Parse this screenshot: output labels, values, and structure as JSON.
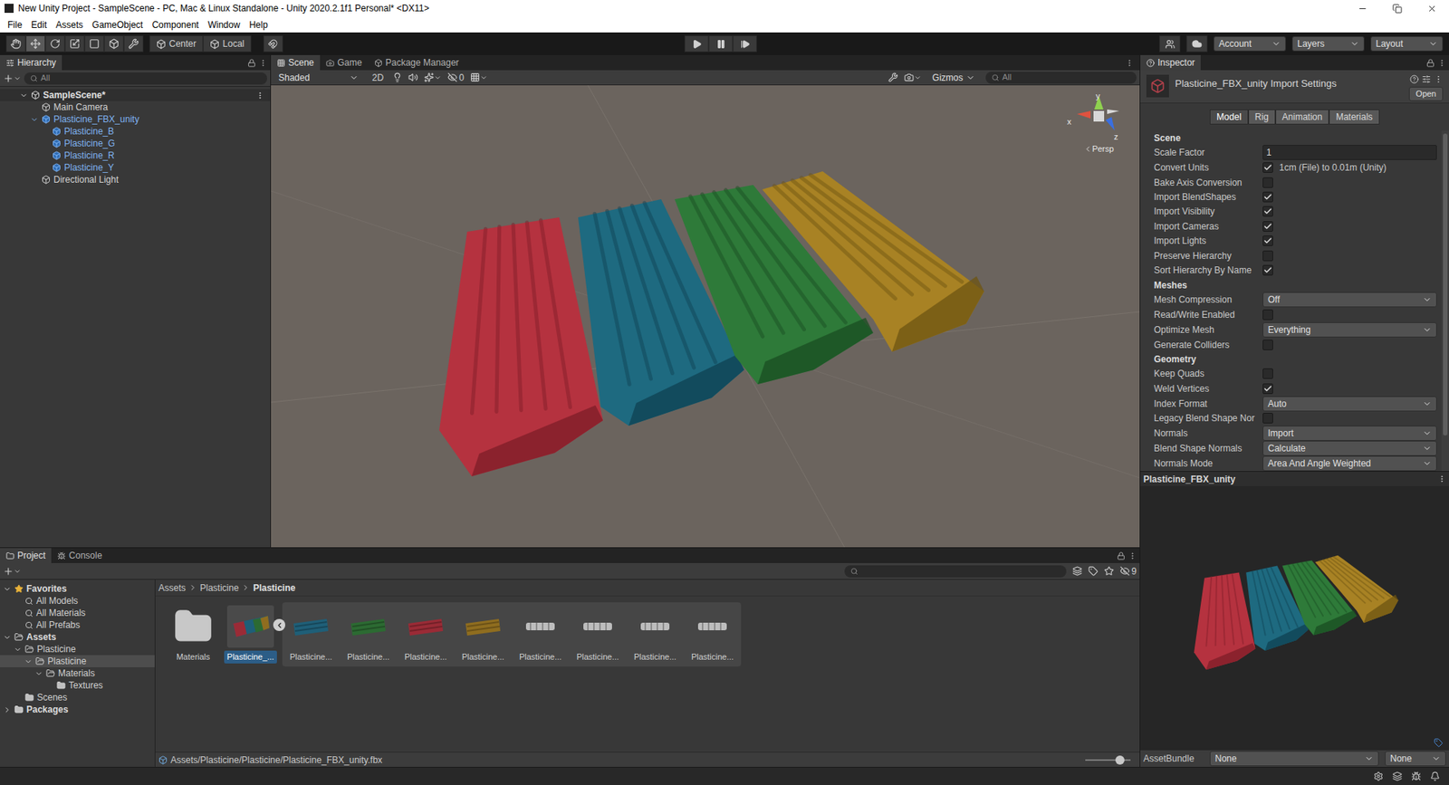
{
  "window": {
    "title": "New Unity Project - SampleScene - PC, Mac & Linux Standalone - Unity 2020.2.1f1 Personal* <DX11>"
  },
  "menu": [
    "File",
    "Edit",
    "Assets",
    "GameObject",
    "Component",
    "Window",
    "Help"
  ],
  "toolbar": {
    "tools": [
      {
        "selected": false
      },
      {
        "selected": true
      },
      {
        "selected": false
      },
      {
        "selected": false
      },
      {
        "selected": false
      },
      {
        "selected": false
      },
      {
        "selected": false
      }
    ],
    "pivot": "Center",
    "space": "Local",
    "account": "Account",
    "layers": "Layers",
    "layout": "Layout"
  },
  "hierarchy": {
    "tab": "Hierarchy",
    "search": "All",
    "items": [
      {
        "label": "SampleScene*",
        "depth": 0,
        "kind": "scene",
        "foldout": "open"
      },
      {
        "label": "Main Camera",
        "depth": 1,
        "kind": "object",
        "foldout": "none"
      },
      {
        "label": "Plasticine_FBX_unity",
        "depth": 1,
        "kind": "prefab",
        "foldout": "open"
      },
      {
        "label": "Plasticine_B",
        "depth": 2,
        "kind": "prefab",
        "foldout": "none"
      },
      {
        "label": "Plasticine_G",
        "depth": 2,
        "kind": "prefab",
        "foldout": "none"
      },
      {
        "label": "Plasticine_R",
        "depth": 2,
        "kind": "prefab",
        "foldout": "none"
      },
      {
        "label": "Plasticine_Y",
        "depth": 2,
        "kind": "prefab",
        "foldout": "none"
      },
      {
        "label": "Directional Light",
        "depth": 1,
        "kind": "object",
        "foldout": "none"
      }
    ]
  },
  "scene": {
    "tabs": [
      {
        "label": "Scene",
        "selected": true
      },
      {
        "label": "Game",
        "selected": false
      },
      {
        "label": "Package Manager",
        "selected": false
      }
    ],
    "shading": "Shaded",
    "mode2d": "2D",
    "hidden_count": "0",
    "gizmos": "Gizmos",
    "search": "All",
    "projection": "Persp",
    "axes": {
      "x": "x",
      "y": "y",
      "z": "z"
    }
  },
  "inspector": {
    "tab": "Inspector",
    "title": "Plasticine_FBX_unity Import Settings",
    "open": "Open",
    "tabs": [
      {
        "label": "Model",
        "selected": true
      },
      {
        "label": "Rig",
        "selected": false
      },
      {
        "label": "Animation",
        "selected": false
      },
      {
        "label": "Materials",
        "selected": false
      }
    ],
    "rows": [
      {
        "kind": "header",
        "label": "Scene"
      },
      {
        "kind": "field",
        "label": "Scale Factor",
        "value": "1"
      },
      {
        "kind": "checkbox",
        "label": "Convert Units",
        "checked": true,
        "note": "1cm (File) to 0.01m (Unity)"
      },
      {
        "kind": "checkbox",
        "label": "Bake Axis Conversion",
        "checked": false
      },
      {
        "kind": "checkbox",
        "label": "Import BlendShapes",
        "checked": true
      },
      {
        "kind": "checkbox",
        "label": "Import Visibility",
        "checked": true
      },
      {
        "kind": "checkbox",
        "label": "Import Cameras",
        "checked": true
      },
      {
        "kind": "checkbox",
        "label": "Import Lights",
        "checked": true
      },
      {
        "kind": "checkbox",
        "label": "Preserve Hierarchy",
        "checked": false
      },
      {
        "kind": "checkbox",
        "label": "Sort Hierarchy By Name",
        "checked": true
      },
      {
        "kind": "header",
        "label": "Meshes"
      },
      {
        "kind": "dropdown",
        "label": "Mesh Compression",
        "value": "Off"
      },
      {
        "kind": "checkbox",
        "label": "Read/Write Enabled",
        "checked": false
      },
      {
        "kind": "dropdown",
        "label": "Optimize Mesh",
        "value": "Everything"
      },
      {
        "kind": "checkbox",
        "label": "Generate Colliders",
        "checked": false
      },
      {
        "kind": "header",
        "label": "Geometry"
      },
      {
        "kind": "checkbox",
        "label": "Keep Quads",
        "checked": false
      },
      {
        "kind": "checkbox",
        "label": "Weld Vertices",
        "checked": true
      },
      {
        "kind": "dropdown",
        "label": "Index Format",
        "value": "Auto"
      },
      {
        "kind": "checkbox",
        "label": "Legacy Blend Shape Nor",
        "checked": false
      },
      {
        "kind": "dropdown",
        "label": "Normals",
        "value": "Import"
      },
      {
        "kind": "dropdown",
        "label": "Blend Shape Normals",
        "value": "Calculate"
      },
      {
        "kind": "dropdown",
        "label": "Normals Mode",
        "value": "Area And Angle Weighted"
      }
    ],
    "preview_title": "Plasticine_FBX_unity",
    "asset_bundle": {
      "label": "AssetBundle",
      "name": "None",
      "variant": "None"
    }
  },
  "project": {
    "tabs": [
      {
        "label": "Project",
        "selected": true
      },
      {
        "label": "Console",
        "selected": false
      }
    ],
    "hidden_count": "9",
    "tree": [
      {
        "label": "Favorites",
        "depth": 0,
        "kind": "favorites",
        "foldout": "open",
        "selected": false
      },
      {
        "label": "All Models",
        "depth": 1,
        "kind": "search",
        "foldout": "none",
        "selected": false
      },
      {
        "label": "All Materials",
        "depth": 1,
        "kind": "search",
        "foldout": "none",
        "selected": false
      },
      {
        "label": "All Prefabs",
        "depth": 1,
        "kind": "search",
        "foldout": "none",
        "selected": false
      },
      {
        "label": "Assets",
        "depth": 0,
        "kind": "folder",
        "foldout": "open",
        "selected": false
      },
      {
        "label": "Plasticine",
        "depth": 1,
        "kind": "folder",
        "foldout": "open",
        "selected": false
      },
      {
        "label": "Plasticine",
        "depth": 2,
        "kind": "folder",
        "foldout": "open",
        "selected": true
      },
      {
        "label": "Materials",
        "depth": 3,
        "kind": "folder",
        "foldout": "open",
        "selected": false
      },
      {
        "label": "Textures",
        "depth": 4,
        "kind": "folder",
        "foldout": "none",
        "selected": false
      },
      {
        "label": "Scenes",
        "depth": 1,
        "kind": "folder",
        "foldout": "none",
        "selected": false
      },
      {
        "label": "Packages",
        "depth": 0,
        "kind": "folder",
        "foldout": "closed",
        "selected": false
      }
    ],
    "breadcrumbs": [
      "Assets",
      "Plasticine",
      "Plasticine"
    ],
    "assets": [
      {
        "label": "Materials",
        "kind": "folder",
        "selected": false
      },
      {
        "label": "Plasticine_...",
        "kind": "model",
        "selected": true,
        "expanded": true
      },
      {
        "label": "Plasticine...",
        "kind": "object",
        "selected": false,
        "color": "#1f5f78"
      },
      {
        "label": "Plasticine...",
        "kind": "object",
        "selected": false,
        "color": "#2c6a32"
      },
      {
        "label": "Plasticine...",
        "kind": "object",
        "selected": false,
        "color": "#9a2b36"
      },
      {
        "label": "Plasticine...",
        "kind": "object",
        "selected": false,
        "color": "#8f6d1f"
      },
      {
        "label": "Plasticine...",
        "kind": "mesh",
        "selected": false
      },
      {
        "label": "Plasticine...",
        "kind": "mesh",
        "selected": false
      },
      {
        "label": "Plasticine...",
        "kind": "mesh",
        "selected": false
      },
      {
        "label": "Plasticine...",
        "kind": "mesh",
        "selected": false
      }
    ],
    "path": "Assets/Plasticine/Plasticine/Plasticine_FBX_unity.fbx"
  }
}
